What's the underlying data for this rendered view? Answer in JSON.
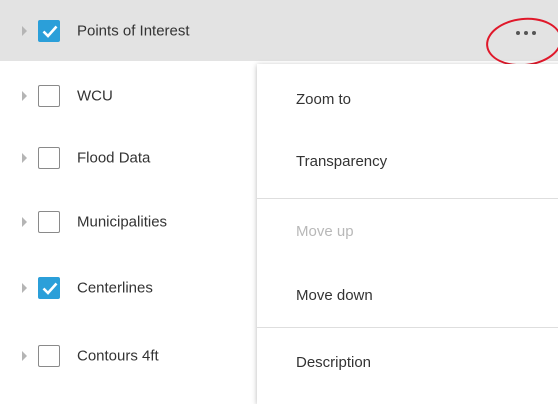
{
  "layers": [
    {
      "label": "Points of Interest",
      "checked": true,
      "selected": true
    },
    {
      "label": "WCU",
      "checked": false,
      "selected": false
    },
    {
      "label": "Flood Data",
      "checked": false,
      "selected": false
    },
    {
      "label": "Municipalities",
      "checked": false,
      "selected": false
    },
    {
      "label": "Centerlines",
      "checked": true,
      "selected": false
    },
    {
      "label": "Contours 4ft",
      "checked": false,
      "selected": false
    }
  ],
  "context_menu": {
    "items": [
      {
        "label": "Zoom to",
        "enabled": true
      },
      {
        "label": "Transparency",
        "enabled": true
      },
      {
        "label": "Move up",
        "enabled": false
      },
      {
        "label": "Move down",
        "enabled": true
      },
      {
        "label": "Description",
        "enabled": true
      }
    ]
  },
  "icons": {
    "expander": "caret-right-icon",
    "checkbox": "checkbox-icon",
    "more": "more-options-icon"
  },
  "colors": {
    "checkbox_checked": "#2b9fd9",
    "selected_row": "#e3e3e3",
    "annotation_ring": "#e0182a",
    "disabled_text": "#b8b8b8"
  }
}
